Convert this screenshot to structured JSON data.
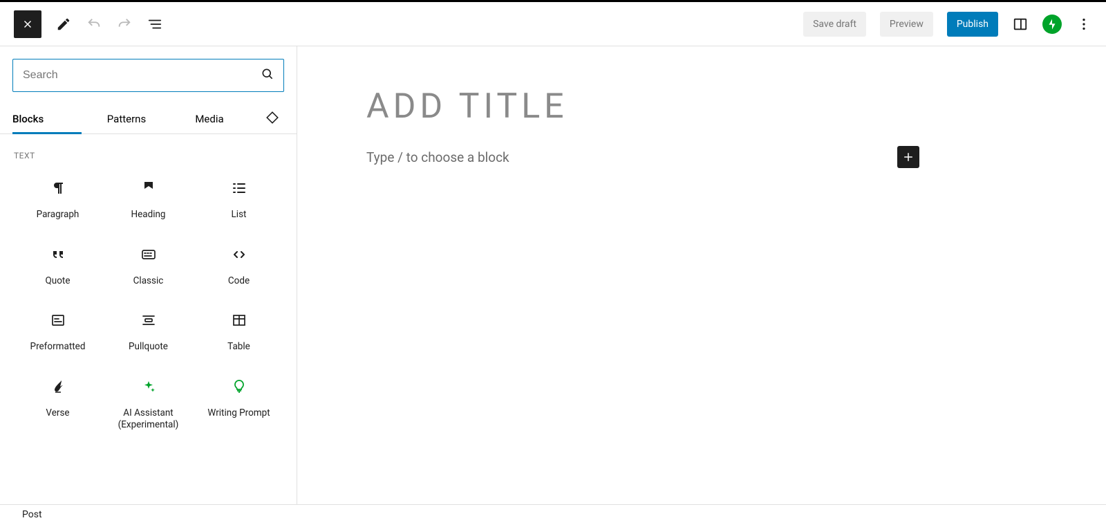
{
  "toolbar": {
    "save_draft": "Save draft",
    "preview": "Preview",
    "publish": "Publish"
  },
  "inserter": {
    "search_placeholder": "Search",
    "tabs": {
      "blocks": "Blocks",
      "patterns": "Patterns",
      "media": "Media"
    },
    "category_text": "TEXT",
    "blocks": [
      {
        "name": "paragraph",
        "label": "Paragraph"
      },
      {
        "name": "heading",
        "label": "Heading"
      },
      {
        "name": "list",
        "label": "List"
      },
      {
        "name": "quote",
        "label": "Quote"
      },
      {
        "name": "classic",
        "label": "Classic"
      },
      {
        "name": "code",
        "label": "Code"
      },
      {
        "name": "preformatted",
        "label": "Preformatted"
      },
      {
        "name": "pullquote",
        "label": "Pullquote"
      },
      {
        "name": "table",
        "label": "Table"
      },
      {
        "name": "verse",
        "label": "Verse"
      },
      {
        "name": "ai-assistant",
        "label": "AI Assistant (Experimental)"
      },
      {
        "name": "writing-prompt",
        "label": "Writing Prompt"
      }
    ]
  },
  "editor": {
    "title_placeholder": "Add title",
    "body_placeholder": "Type / to choose a block"
  },
  "footer": {
    "breadcrumb": "Post"
  }
}
